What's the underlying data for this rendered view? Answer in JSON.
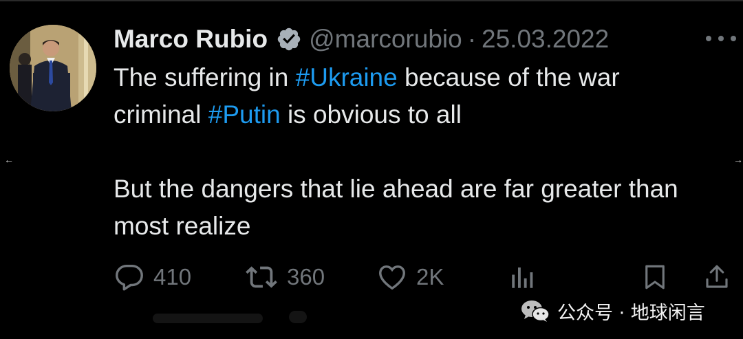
{
  "author": {
    "name": "Marco Rubio",
    "handle": "@marcorubio",
    "separator": "·",
    "date": "25.03.2022",
    "verified_icon": "verified-badge-icon",
    "avatar_desc": "profile-photo"
  },
  "tweet": {
    "line1_pre": "The suffering in ",
    "tag1": "#Ukraine",
    "line1_post": " because of the war",
    "line2_pre": "criminal ",
    "tag2": "#Putin",
    "line2_post": " is obvious to all",
    "para2": "But the dangers that lie ahead are far greater than most realize"
  },
  "actions": {
    "reply": {
      "icon": "reply-icon",
      "count": "410"
    },
    "retweet": {
      "icon": "retweet-icon",
      "count": "360"
    },
    "like": {
      "icon": "heart-icon",
      "count": "2K"
    },
    "views": {
      "icon": "views-icon"
    },
    "bookmark": {
      "icon": "bookmark-icon"
    },
    "share": {
      "icon": "share-icon"
    }
  },
  "nav": {
    "left_arrow": "←",
    "right_arrow": "→"
  },
  "watermark": {
    "text": "公众号 · 地球闲言"
  },
  "colors": {
    "background": "#000000",
    "text": "#e7e9ea",
    "muted": "#71767b",
    "hashtag": "#1d9bf0"
  }
}
